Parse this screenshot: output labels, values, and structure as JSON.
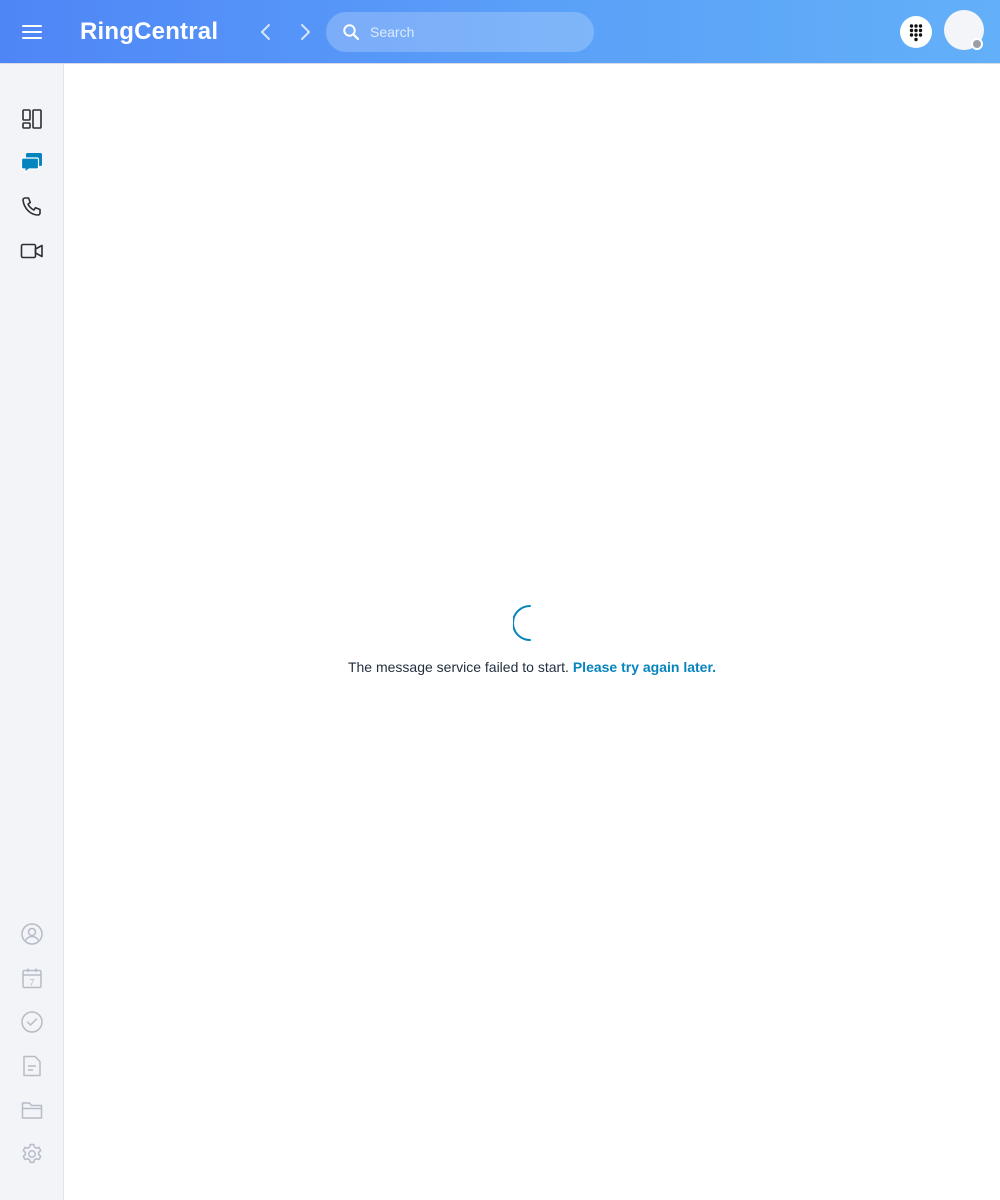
{
  "app": {
    "brand": "RingCentral"
  },
  "header": {
    "search": {
      "placeholder": "Search",
      "value": ""
    },
    "icons": {
      "menu": "hamburger-menu-icon",
      "back": "chevron-left-icon",
      "forward": "chevron-right-icon",
      "search": "search-icon",
      "dialpad": "dialpad-icon"
    },
    "presence_status_color": "#9aa0a6"
  },
  "sidebar": {
    "top_items": [
      {
        "id": "dashboard",
        "icon": "dashboard-icon",
        "active": false
      },
      {
        "id": "messages",
        "icon": "messages-icon",
        "active": true
      },
      {
        "id": "phone",
        "icon": "phone-icon",
        "active": false
      },
      {
        "id": "video",
        "icon": "video-icon",
        "active": false
      }
    ],
    "bottom_items": [
      {
        "id": "contacts",
        "icon": "contacts-icon"
      },
      {
        "id": "calendar",
        "icon": "calendar-icon",
        "text": "7"
      },
      {
        "id": "tasks",
        "icon": "tasks-icon"
      },
      {
        "id": "notes",
        "icon": "notes-icon"
      },
      {
        "id": "files",
        "icon": "folder-icon"
      },
      {
        "id": "settings",
        "icon": "settings-icon"
      }
    ]
  },
  "main": {
    "status_message": "The message service failed to start.",
    "retry_link": "Please try again later.",
    "spinner": "loading-spinner-icon"
  },
  "colors": {
    "header_gradient_start": "#4f86f7",
    "header_gradient_end": "#63b0f8",
    "accent": "#0684bd",
    "sidebar_bg": "#f2f4f8",
    "icon_dark": "#2b2f36",
    "icon_muted": "#b6bcc6"
  }
}
